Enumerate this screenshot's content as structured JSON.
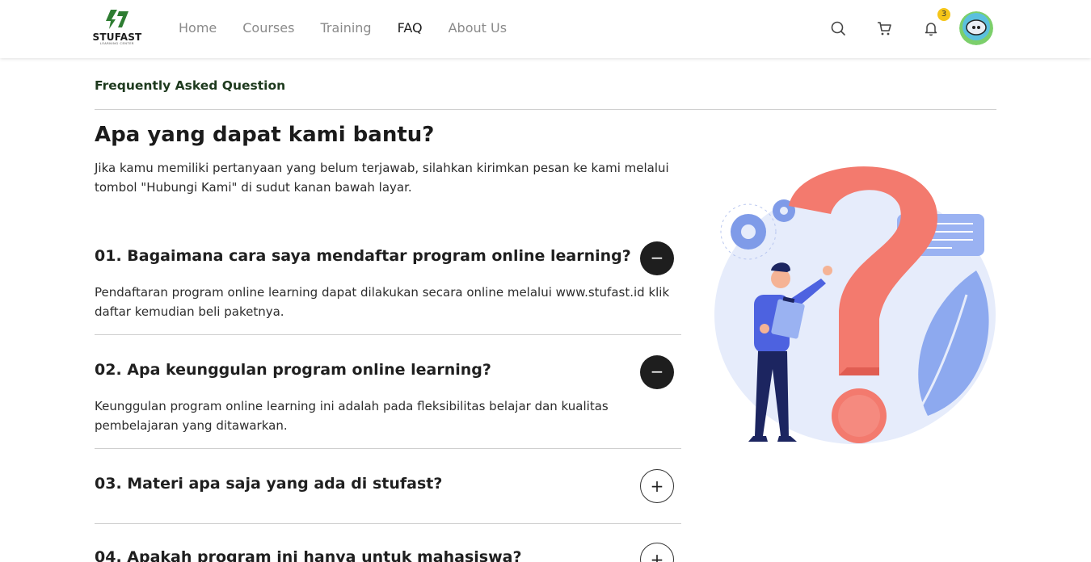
{
  "header": {
    "logo_name": "STUFAST",
    "logo_sub": "LEARNING CENTER",
    "nav": [
      {
        "label": "Home",
        "active": false
      },
      {
        "label": "Courses",
        "active": false
      },
      {
        "label": "Training",
        "active": false
      },
      {
        "label": "FAQ",
        "active": true
      },
      {
        "label": "About Us",
        "active": false
      }
    ],
    "notification_count": "3",
    "icons": [
      "search-icon",
      "cart-icon",
      "bell-icon"
    ]
  },
  "page": {
    "label": "Frequently Asked Question",
    "heading": "Apa yang dapat kami bantu?",
    "intro": "Jika kamu memiliki pertanyaan yang belum terjawab, silahkan kirimkan pesan ke kami melalui tombol \"Hubungi Kami\" di sudut kanan bawah layar."
  },
  "faq": [
    {
      "question": "01. Bagaimana cara saya mendaftar program online learning?",
      "answer": "Pendaftaran program online learning dapat dilakukan secara online melalui www.stufast.id klik daftar kemudian beli paketnya.",
      "toggle": "−",
      "expanded": true
    },
    {
      "question": "02. Apa keunggulan program online learning?",
      "answer": "Keunggulan program online learning ini adalah pada fleksibilitas belajar dan kualitas pembelajaran yang ditawarkan.",
      "toggle": "−",
      "expanded": true
    },
    {
      "question": "03. Materi apa saja yang ada di stufast?",
      "answer": "",
      "toggle": "+",
      "expanded": false
    },
    {
      "question": "04. Apakah program ini hanya untuk mahasiswa?",
      "answer": "",
      "toggle": "+",
      "expanded": false
    }
  ],
  "colors": {
    "brand_green": "#2e7d32",
    "active_toggle": "#1e1e1e",
    "badge": "#f5c518",
    "question_mark": "#f37a6e"
  }
}
